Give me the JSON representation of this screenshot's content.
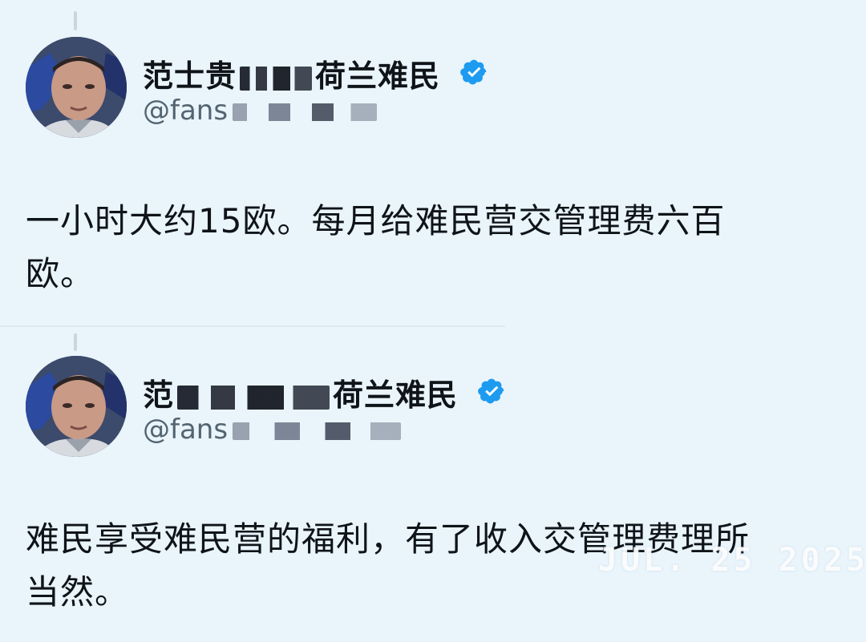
{
  "posts": [
    {
      "display_name_prefix": "范士贵",
      "display_name_suffix": "荷兰难民",
      "handle_prefix": "@fans",
      "verified": true,
      "text_lines": [
        "一小时大约15欧。每月给难民营交管理费六百",
        "欧。"
      ]
    },
    {
      "display_name_prefix": "范",
      "display_name_suffix": "荷兰难民",
      "handle_prefix": "@fans",
      "verified": true,
      "text_lines": [
        "难民享受难民营的福利，有了收入交管理费理所",
        "当然。"
      ]
    }
  ],
  "date_stamp": "JUL. 25 2025",
  "colors": {
    "background": "#e9f4fb",
    "verified_badge": "#1d9bf0",
    "handle": "#536471",
    "text": "#0f1419"
  }
}
